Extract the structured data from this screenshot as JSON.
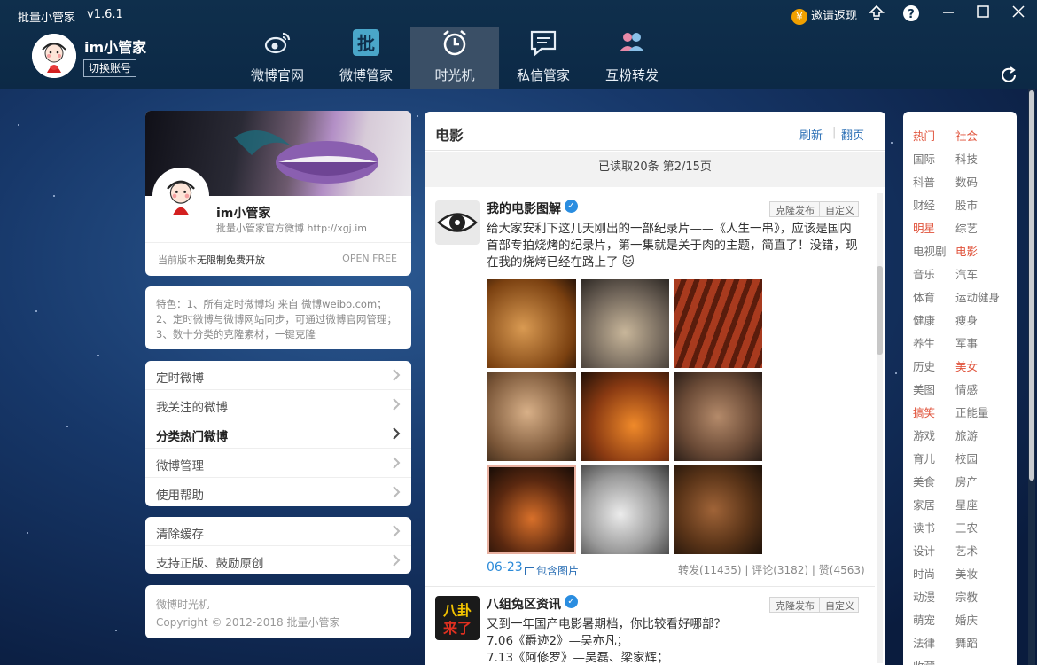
{
  "app": {
    "title": "批量小管家",
    "version": "v1.6.1"
  },
  "user": {
    "name": "im小管家",
    "switch_label": "切换账号"
  },
  "nav": [
    {
      "label": "微博官网",
      "icon": "weibo-icon"
    },
    {
      "label": "微博管家",
      "icon": "pi-badge-icon"
    },
    {
      "label": "时光机",
      "icon": "alarm-clock-icon"
    },
    {
      "label": "私信管家",
      "icon": "message-icon"
    },
    {
      "label": "互粉转发",
      "icon": "users-icon"
    }
  ],
  "topbar": {
    "invite_label": "邀请返现",
    "coin_glyph": "¥"
  },
  "profile": {
    "name": "im小管家",
    "desc": "批量小管家官方微博 http://xgj.im",
    "version_label": "当前版本",
    "version_value": "无限制免费开放",
    "open_free": "OPEN FREE"
  },
  "features": "特色：1、所有定时微博均 来自 微博weibo.com；2、定时微博与微博网站同步，可通过微博官网管理；3、数十分类的克隆素材，一键克隆",
  "menu": [
    "定时微博",
    "我关注的微博",
    "分类热门微博",
    "微博管理",
    "使用帮助"
  ],
  "menu2": [
    "清除缓存",
    "支持正版、鼓励原创"
  ],
  "copyright": {
    "line1": "微博时光机",
    "line2": "Copyright © 2012-2018 批量小管家"
  },
  "feed": {
    "title": "电影",
    "refresh": "刷新",
    "sep": "|",
    "page": "翻页",
    "status": "已读取20条 第2/15页",
    "posts": [
      {
        "author": "我的电影图解",
        "clone": "克隆发布",
        "custom": "自定义",
        "text": "给大家安利下这几天刚出的一部纪录片——《人生一串》，应该是国内首部专拍烧烤的纪录片，第一集就是关于肉的主题，简直了！没错，现在我的烧烤已经在路上了 🐱",
        "date": "06-23",
        "images_label": "包含图片",
        "stats": "转发(11435) | 评论(3182) | 赞(4563)"
      },
      {
        "author": "八组兔区资讯",
        "clone": "克隆发布",
        "custom": "自定义",
        "text_lines": [
          "又到一年国产电影暑期档，你比较看好哪部？",
          "7.06《爵迹2》—吴亦凡；",
          "7.13《阿修罗》—吴磊、梁家辉；"
        ]
      }
    ]
  },
  "tags": [
    [
      "热门",
      "社会"
    ],
    [
      "国际",
      "科技"
    ],
    [
      "科普",
      "数码"
    ],
    [
      "财经",
      "股市"
    ],
    [
      "明星",
      "综艺"
    ],
    [
      "电视剧",
      "电影"
    ],
    [
      "音乐",
      "汽车"
    ],
    [
      "体育",
      "运动健身"
    ],
    [
      "健康",
      "瘦身"
    ],
    [
      "养生",
      "军事"
    ],
    [
      "历史",
      "美女"
    ],
    [
      "美图",
      "情感"
    ],
    [
      "搞笑",
      "正能量"
    ],
    [
      "游戏",
      "旅游"
    ],
    [
      "育儿",
      "校园"
    ],
    [
      "美食",
      "房产"
    ],
    [
      "家居",
      "星座"
    ],
    [
      "读书",
      "三农"
    ],
    [
      "设计",
      "艺术"
    ],
    [
      "时尚",
      "美妆"
    ],
    [
      "动漫",
      "宗教"
    ],
    [
      "萌宠",
      "婚庆"
    ],
    [
      "法律",
      "舞蹈"
    ],
    [
      "收藏",
      ""
    ]
  ],
  "hot_tags": [
    "热门",
    "社会",
    "明星",
    "电影",
    "美女",
    "搞笑"
  ],
  "colors": {
    "accent": "#2b6fb5",
    "hot": "#e0533b",
    "titlebar": "#0f2f4c"
  }
}
